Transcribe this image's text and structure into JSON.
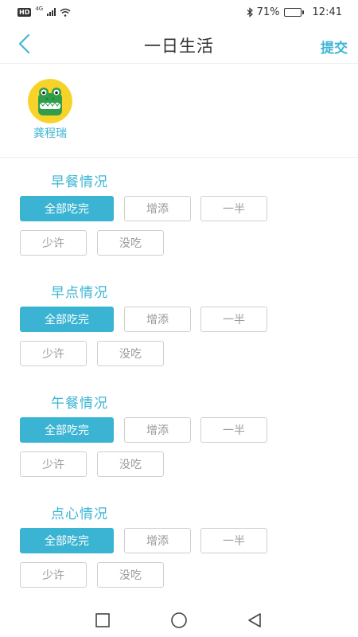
{
  "status_bar": {
    "hd": "HD",
    "network": "4G",
    "battery": "71%",
    "battery_level": 0.71,
    "time": "12:41"
  },
  "header": {
    "title": "一日生活",
    "submit_label": "提交",
    "back_icon": "chevron-left-icon"
  },
  "child": {
    "name": "龚程瑞",
    "avatar_icon": "crocodile-avatar-icon"
  },
  "sections": [
    {
      "title": "早餐情况",
      "options": [
        "全部吃完",
        "增添",
        "一半",
        "少许",
        "没吃"
      ],
      "selected": "全部吃完"
    },
    {
      "title": "早点情况",
      "options": [
        "全部吃完",
        "增添",
        "一半",
        "少许",
        "没吃"
      ],
      "selected": "全部吃完"
    },
    {
      "title": "午餐情况",
      "options": [
        "全部吃完",
        "增添",
        "一半",
        "少许",
        "没吃"
      ],
      "selected": "全部吃完"
    },
    {
      "title": "点心情况",
      "options": [
        "全部吃完",
        "增添",
        "一半",
        "少许",
        "没吃"
      ],
      "selected": "全部吃完"
    }
  ],
  "colors": {
    "accent": "#3bb4d3",
    "border": "#cfcfcf",
    "muted_text": "#9a9a9a"
  }
}
